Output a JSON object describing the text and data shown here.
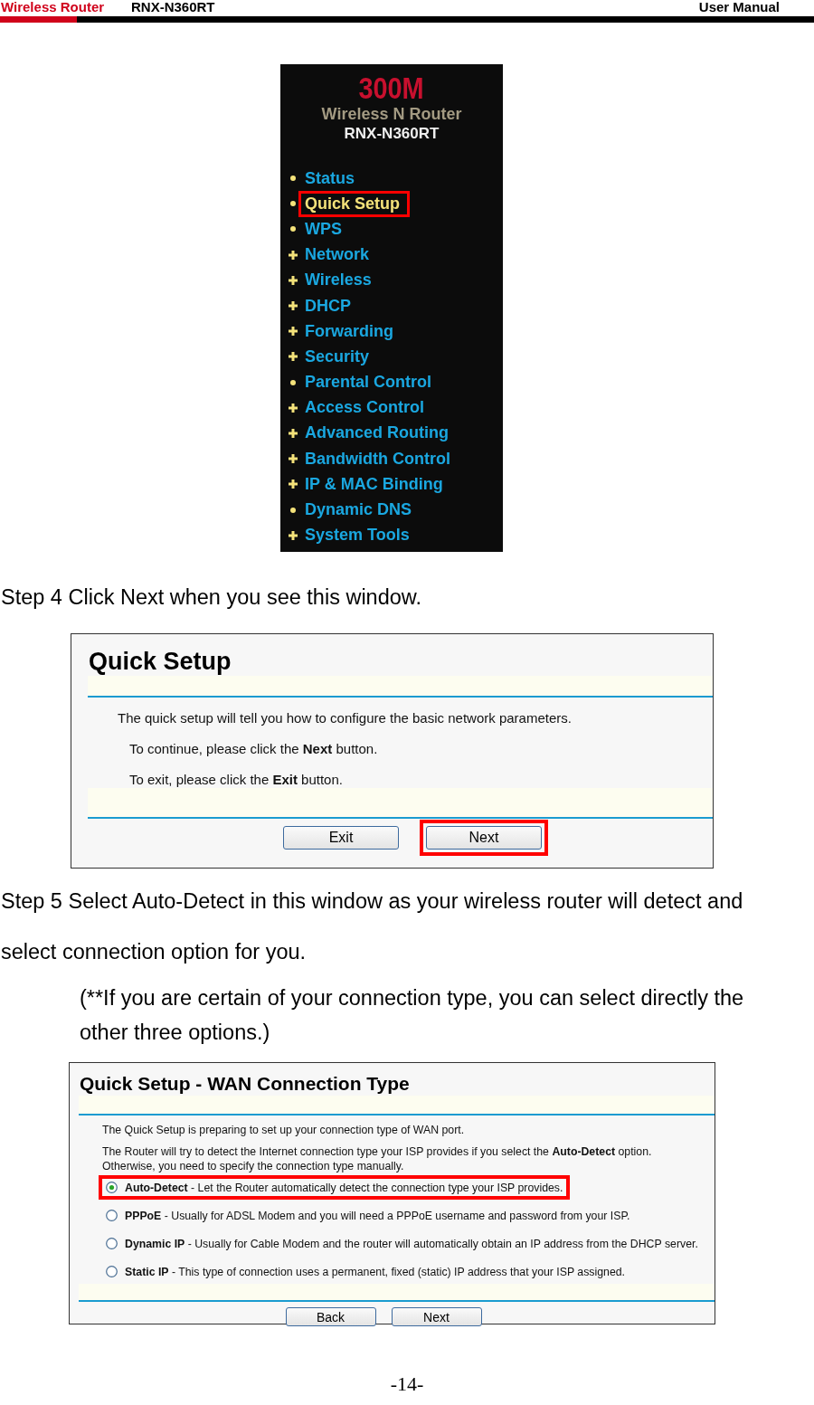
{
  "header": {
    "brand": "Wireless Router",
    "model": "RNX-N360RT",
    "doc": "User Manual"
  },
  "menu": {
    "logo_big": "300M",
    "logo_sub": "Wireless N Router",
    "logo_model": "RNX-N360RT",
    "items": [
      {
        "label": "Status",
        "kind": "dot",
        "selected": false
      },
      {
        "label": "Quick Setup",
        "kind": "dot",
        "selected": true
      },
      {
        "label": "WPS",
        "kind": "dot",
        "selected": false
      },
      {
        "label": "Network",
        "kind": "plus",
        "selected": false
      },
      {
        "label": "Wireless",
        "kind": "plus",
        "selected": false
      },
      {
        "label": "DHCP",
        "kind": "plus",
        "selected": false
      },
      {
        "label": "Forwarding",
        "kind": "plus",
        "selected": false
      },
      {
        "label": "Security",
        "kind": "plus",
        "selected": false
      },
      {
        "label": "Parental Control",
        "kind": "dot",
        "selected": false
      },
      {
        "label": "Access Control",
        "kind": "plus",
        "selected": false
      },
      {
        "label": "Advanced Routing",
        "kind": "plus",
        "selected": false
      },
      {
        "label": "Bandwidth Control",
        "kind": "plus",
        "selected": false
      },
      {
        "label": "IP & MAC Binding",
        "kind": "plus",
        "selected": false
      },
      {
        "label": "Dynamic DNS",
        "kind": "dot",
        "selected": false
      },
      {
        "label": "System Tools",
        "kind": "plus",
        "selected": false
      }
    ]
  },
  "step4": "Step 4 Click Next when you see this window.",
  "quick_setup": {
    "title": "Quick Setup",
    "intro": "The quick setup will tell you how to configure the basic network parameters.",
    "lines": [
      "To continue, please click the **Next** button.",
      "To exit, please click the **Exit** button."
    ],
    "buttons": [
      {
        "label": "Exit",
        "highlighted": false
      },
      {
        "label": "Next",
        "highlighted": true
      }
    ]
  },
  "step5": "Step 5 Select Auto-Detect in this window as your wireless router will detect and select connection option for you.",
  "note": "(**If you are certain of your connection type, you can select directly the other three options.)",
  "wan": {
    "title": "Quick Setup - WAN Connection Type",
    "intro": "The Quick Setup is preparing to set up your connection type of WAN port.",
    "info": "The Router will try to detect the Internet connection type your ISP provides if you select the **Auto-Detect** option. Otherwise, you need to specify the connection type manually.",
    "options": [
      {
        "text": "**Auto-Detect** - Let the Router automatically detect the connection type your ISP provides.",
        "selected": true,
        "highlighted": true
      },
      {
        "text": "**PPPoE** - Usually for ADSL Modem and you will need a PPPoE username and password from your ISP.",
        "selected": false,
        "highlighted": false
      },
      {
        "text": "**Dynamic IP** - Usually for Cable Modem and the router will automatically obtain an IP address from the DHCP server.",
        "selected": false,
        "highlighted": false
      },
      {
        "text": "**Static IP** - This type of connection uses a permanent, fixed (static) IP address that your ISP assigned.",
        "selected": false,
        "highlighted": false
      }
    ],
    "buttons": [
      {
        "label": "Back"
      },
      {
        "label": "Next"
      }
    ]
  },
  "page_number": "-14-"
}
